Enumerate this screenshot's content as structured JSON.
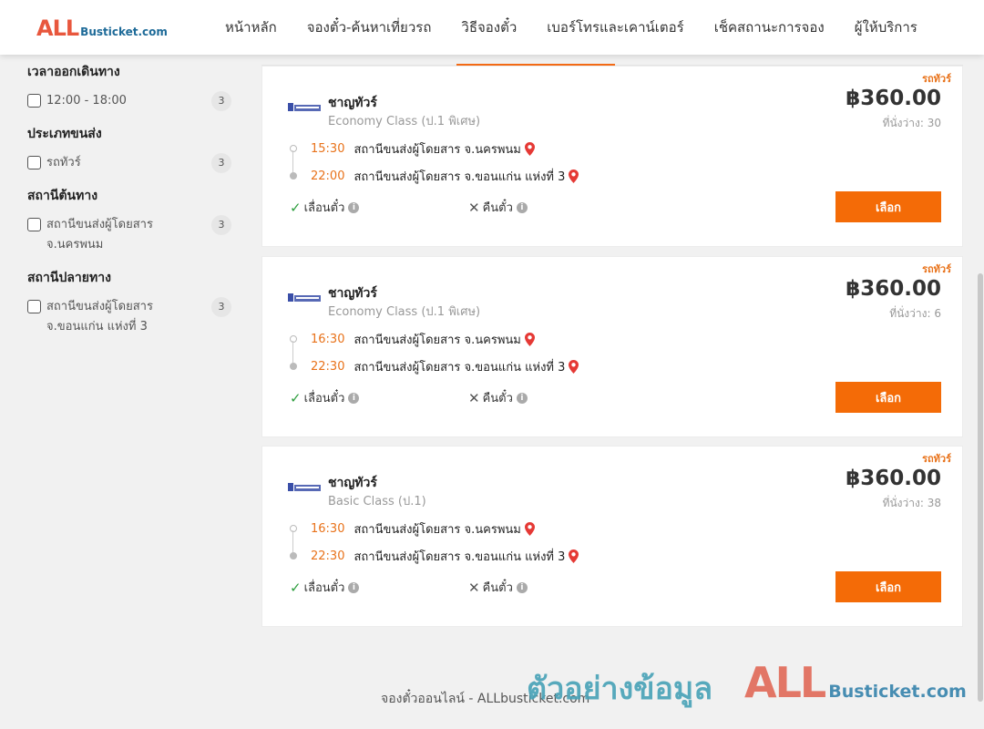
{
  "header": {
    "logo_main": "ALL",
    "logo_rest": "Busticket.com",
    "nav": [
      "หน้าหลัก",
      "จองตั๋ว-ค้นหาเที่ยวรถ",
      "วิธีจองตั๋ว",
      "เบอร์โทรและเคาน์เตอร์",
      "เช็คสถานะการจอง",
      "ผู้ให้บริการ"
    ]
  },
  "filters": [
    {
      "title": "เวลาออกเดินทาง",
      "options": [
        {
          "label": "12:00 - 18:00",
          "count": "3",
          "checked": false
        }
      ]
    },
    {
      "title": "ประเภทขนส่ง",
      "options": [
        {
          "label": "รถทัวร์",
          "count": "3",
          "checked": false
        }
      ]
    },
    {
      "title": "สถานีต้นทาง",
      "options": [
        {
          "label": "สถานีขนส่งผู้โดยสาร จ.นครพนม",
          "count": "3",
          "checked": false
        }
      ]
    },
    {
      "title": "สถานีปลายทาง",
      "options": [
        {
          "label": "สถานีขนส่งผู้โดยสาร จ.ขอนแก่น แห่งที่ 3",
          "count": "3",
          "checked": false
        }
      ]
    }
  ],
  "trips": [
    {
      "tag": "รถทัวร์",
      "operator": "ชาญทัวร์",
      "bus_class": "Economy Class (ป.1 พิเศษ)",
      "price": "฿360.00",
      "seats": "ที่นั่งว่าง: 30",
      "depart_time": "15:30",
      "depart_station": "สถานีขนส่งผู้โดยสาร จ.นครพนม",
      "arrive_time": "22:00",
      "arrive_station": "สถานีขนส่งผู้โดยสาร จ.ขอนแก่น แห่งที่ 3",
      "reschedule": "เลื่อนตั๋ว",
      "refund": "คืนตั๋ว",
      "button": "เลือก"
    },
    {
      "tag": "รถทัวร์",
      "operator": "ชาญทัวร์",
      "bus_class": "Economy Class (ป.1 พิเศษ)",
      "price": "฿360.00",
      "seats": "ที่นั่งว่าง: 6",
      "depart_time": "16:30",
      "depart_station": "สถานีขนส่งผู้โดยสาร จ.นครพนม",
      "arrive_time": "22:30",
      "arrive_station": "สถานีขนส่งผู้โดยสาร จ.ขอนแก่น แห่งที่ 3",
      "reschedule": "เลื่อนตั๋ว",
      "refund": "คืนตั๋ว",
      "button": "เลือก"
    },
    {
      "tag": "รถทัวร์",
      "operator": "ชาญทัวร์",
      "bus_class": "Basic Class (ป.1)",
      "price": "฿360.00",
      "seats": "ที่นั่งว่าง: 38",
      "depart_time": "16:30",
      "depart_station": "สถานีขนส่งผู้โดยสาร จ.นครพนม",
      "arrive_time": "22:30",
      "arrive_station": "สถานีขนส่งผู้โดยสาร จ.ขอนแก่น แห่งที่ 3",
      "reschedule": "เลื่อนตั๋ว",
      "refund": "คืนตั๋ว",
      "button": "เลือก"
    }
  ],
  "footer": {
    "text": "จองตั๋วออนไลน์ - ALLbusticket.com"
  },
  "watermark": {
    "text": "ตัวอย่างข้อมูล",
    "logo_main": "ALL",
    "logo_rest": "Busticket.com"
  },
  "colors": {
    "accent": "#f46b07",
    "time": "#e8721a",
    "pin": "#e53935",
    "check": "#2e9e3e"
  }
}
